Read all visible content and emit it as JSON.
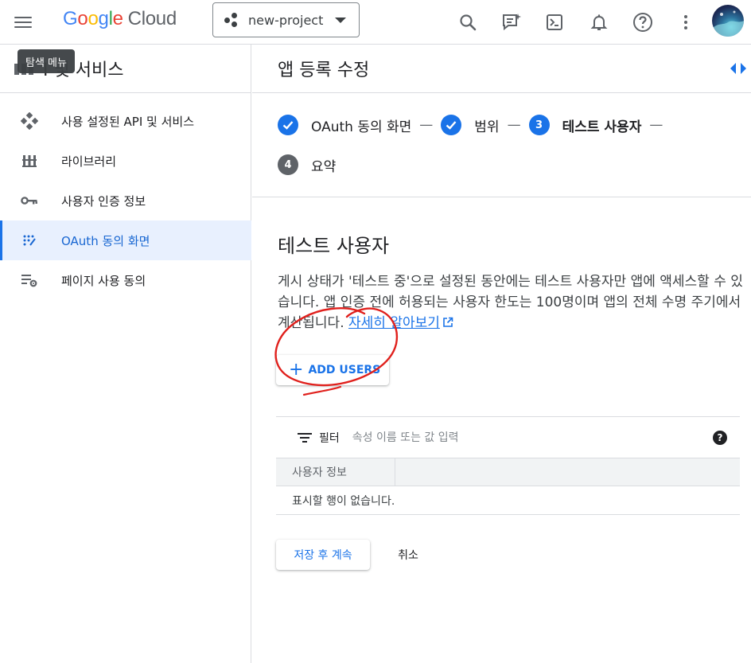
{
  "header": {
    "logo_google": [
      "G",
      "o",
      "o",
      "g",
      "l",
      "e"
    ],
    "logo_cloud": "Cloud",
    "project_name": "new-project"
  },
  "tooltip": {
    "text": "탐색 메뉴"
  },
  "sidebar": {
    "title": "API 및 서비스",
    "title_visible": "I 및 서비스",
    "items": [
      {
        "label": "사용 설정된 API 및 서비스",
        "icon": "api-diamond-icon"
      },
      {
        "label": "라이브러리",
        "icon": "library-icon"
      },
      {
        "label": "사용자 인증 정보",
        "icon": "key-icon"
      },
      {
        "label": "OAuth 동의 화면",
        "icon": "oauth-consent-icon",
        "active": true
      },
      {
        "label": "페이지 사용 동의",
        "icon": "page-usage-settings-icon"
      }
    ]
  },
  "main": {
    "page_title": "앱 등록 수정",
    "steps": [
      {
        "label": "OAuth 동의 화면",
        "state": "done"
      },
      {
        "label": "범위",
        "state": "done"
      },
      {
        "number": "3",
        "label": "테스트 사용자",
        "state": "current"
      },
      {
        "number": "4",
        "label": "요약",
        "state": "todo"
      }
    ],
    "step_separator": "—",
    "section_title": "테스트 사용자",
    "description": "게시 상태가 '테스트 중'으로 설정된 동안에는 테스트 사용자만 앱에 액세스할 수 있습니다. 앱 인증 전에 허용되는 사용자 한도는 100명이며 앱의 전체 수명 주기에서 계산됩니다.",
    "learn_more": "자세히 알아보기",
    "add_users_label": "ADD USERS",
    "filter": {
      "label": "필터",
      "placeholder": "속성 이름 또는 값 입력"
    },
    "table": {
      "column_header": "사용자 정보",
      "empty_text": "표시할 행이 없습니다."
    },
    "save_label": "저장 후 계속",
    "cancel_label": "취소"
  },
  "colors": {
    "accent": "#1a73e8",
    "active_nav_bg": "#e8f0fe",
    "annotation": "#e0201c"
  }
}
